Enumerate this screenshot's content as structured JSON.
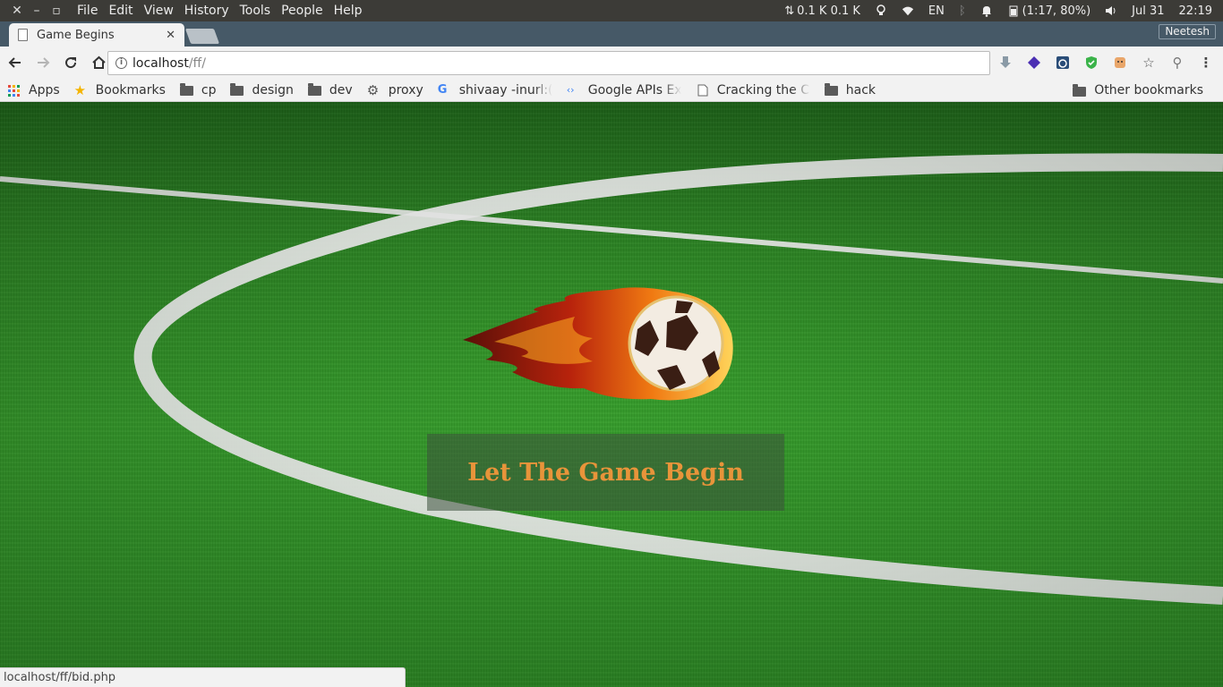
{
  "system_panel": {
    "menu": [
      "File",
      "Edit",
      "View",
      "History",
      "Tools",
      "People",
      "Help"
    ],
    "network": "0.1 K 0.1 K",
    "keyboard": "EN",
    "battery": "(1:17, 80%)",
    "date": "Jul 31",
    "time": "22:19"
  },
  "browser": {
    "tab": {
      "title": "Game Begins"
    },
    "profile_name": "Neetesh",
    "address": {
      "host": "localhost",
      "path": "/ff/"
    },
    "bookmarks": {
      "apps": "Apps",
      "bookmarks": "Bookmarks",
      "cp": "cp",
      "design": "design",
      "dev": "dev",
      "proxy": "proxy",
      "shivaay": "shivaay -inurl:(ht",
      "google_apis": "Google APIs Expl",
      "cracking": "Cracking the Coc",
      "hack": "hack",
      "other": "Other bookmarks"
    },
    "status_url": "localhost/ff/bid.php"
  },
  "page": {
    "heading": "Let The Game Begin"
  },
  "colors": {
    "heading": "#e8943a",
    "grass": "#2d8a24",
    "tabstrip": "#465967"
  }
}
